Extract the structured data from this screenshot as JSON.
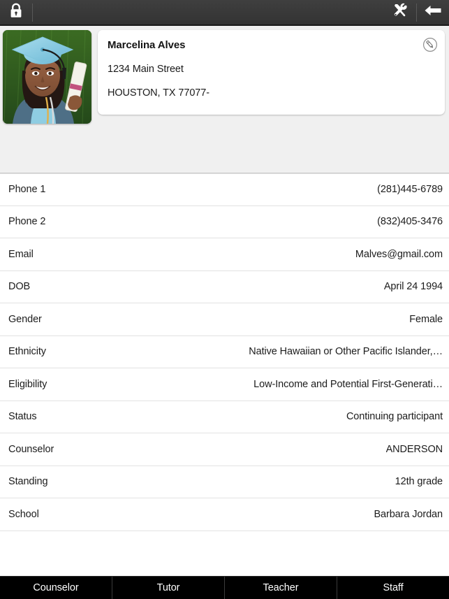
{
  "topbar": {
    "lock_icon": "lock-icon",
    "tools_icon": "tools-icon",
    "back_icon": "back-arrow-icon"
  },
  "profile": {
    "photo_alt": "graduate-portrait",
    "name": "Marcelina Alves",
    "address_line1": "1234 Main Street",
    "address_line2": "HOUSTON, TX 77077-",
    "edit_icon": "edit-pencil-icon"
  },
  "details": [
    {
      "label": "Phone 1",
      "value": "(281)445-6789"
    },
    {
      "label": "Phone 2",
      "value": "(832)405-3476"
    },
    {
      "label": "Email",
      "value": "Malves@gmail.com"
    },
    {
      "label": "DOB",
      "value": "April 24 1994"
    },
    {
      "label": "Gender",
      "value": "Female"
    },
    {
      "label": "Ethnicity",
      "value": "Native Hawaiian or Other Pacific Islander,…"
    },
    {
      "label": "Eligibility",
      "value": "Low-Income and Potential First-Generati…"
    },
    {
      "label": "Status",
      "value": "Continuing participant"
    },
    {
      "label": "Counselor",
      "value": "ANDERSON"
    },
    {
      "label": "Standing",
      "value": "12th grade"
    },
    {
      "label": "School",
      "value": "Barbara Jordan"
    }
  ],
  "tabs": [
    {
      "label": "Counselor"
    },
    {
      "label": "Tutor"
    },
    {
      "label": "Teacher"
    },
    {
      "label": "Staff"
    }
  ],
  "colors": {
    "topbar": "#363636",
    "header_bg": "#f0f0f0",
    "tabbar": "#000000",
    "text": "#1c1c1c",
    "divider": "#e2e2e2"
  }
}
